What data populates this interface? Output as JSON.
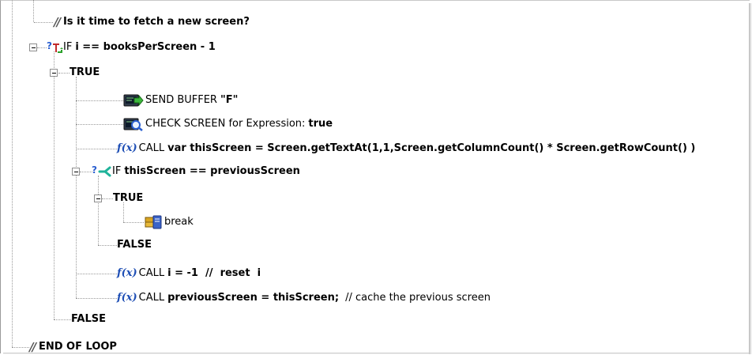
{
  "tree": {
    "comment_fetch": "Is it time to fetch a new screen?",
    "if1": {
      "keyword": "IF",
      "condition": "i == booksPerScreen - 1"
    },
    "true1": "TRUE",
    "send_buffer": {
      "label": "SEND BUFFER",
      "value": "\"F\""
    },
    "check_screen": {
      "label": "CHECK SCREEN for Expression:",
      "value": "true"
    },
    "call1": {
      "keyword": "CALL",
      "code": "var thisScreen = Screen.getTextAt(1,1,Screen.getColumnCount() * Screen.getRowCount() )"
    },
    "if2": {
      "keyword": "IF",
      "condition": "thisScreen == previousScreen"
    },
    "true2": "TRUE",
    "break_label": "break",
    "false2": "FALSE",
    "call2": {
      "keyword": "CALL",
      "code": "i = -1  //  reset  i"
    },
    "call3": {
      "keyword": "CALL",
      "code": "previousScreen = thisScreen;",
      "comment": "// cache the previous screen"
    },
    "false1": "FALSE",
    "end_loop": "END OF LOOP"
  },
  "glyphs": {
    "fx": "f(x)",
    "comment": "//",
    "question": "?"
  },
  "icons": [
    "comment-icon",
    "if-icon",
    "send-buffer-icon",
    "check-screen-icon",
    "function-icon",
    "branch-if-icon",
    "break-icon"
  ],
  "colors": {
    "fx_blue": "#1f4fb5",
    "tree_line": "#9a9a9a",
    "if_icon_green": "#2aa12a",
    "branch_teal": "#1fb39a"
  }
}
